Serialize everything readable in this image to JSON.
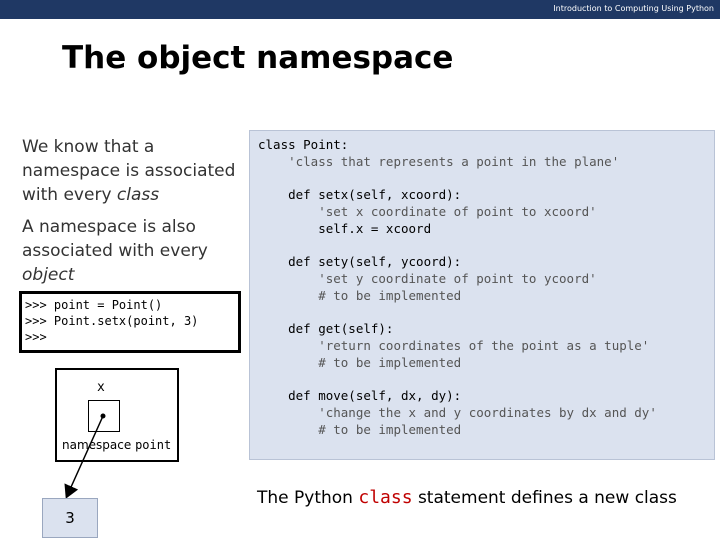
{
  "header": {
    "course": "Introduction to Computing Using Python",
    "color": "#1f3864"
  },
  "slide": {
    "title": "The object namespace"
  },
  "left_text": {
    "para1_a": "We know that a",
    "para1_b": "namespace is associated",
    "para1_c": "with every ",
    "para1_em": "class",
    "para2_a": "A namespace is also",
    "para2_b": "associated with every",
    "para2_em": "object"
  },
  "shell": {
    "lines": [
      ">>> point = Point()",
      ">>> Point.setx(point, 3)",
      ">>>"
    ]
  },
  "code": {
    "lines": [
      "class Point:",
      "    'class that represents a point in the plane'",
      "    def setx(self, xcoord):",
      "        'set x coordinate of point to xcoord'",
      "        self.x = xcoord",
      "    def sety(self, ycoord):",
      "        'set y coordinate of point to ycoord'",
      "        # to be implemented",
      "    def get(self):",
      "        'return coordinates of the point as a tuple'",
      "        # to be implemented",
      "    def move(self, dx, dy):",
      "        'change the x and y coordinates by dx and dy'",
      "        # to be implemented"
    ]
  },
  "diagram": {
    "variable": "x",
    "namespace_word": "namespace",
    "namespace_name": "point",
    "value": "3"
  },
  "bottom": {
    "prefix": "The Python ",
    "keyword": "class",
    "suffix": " statement defines a new class"
  }
}
